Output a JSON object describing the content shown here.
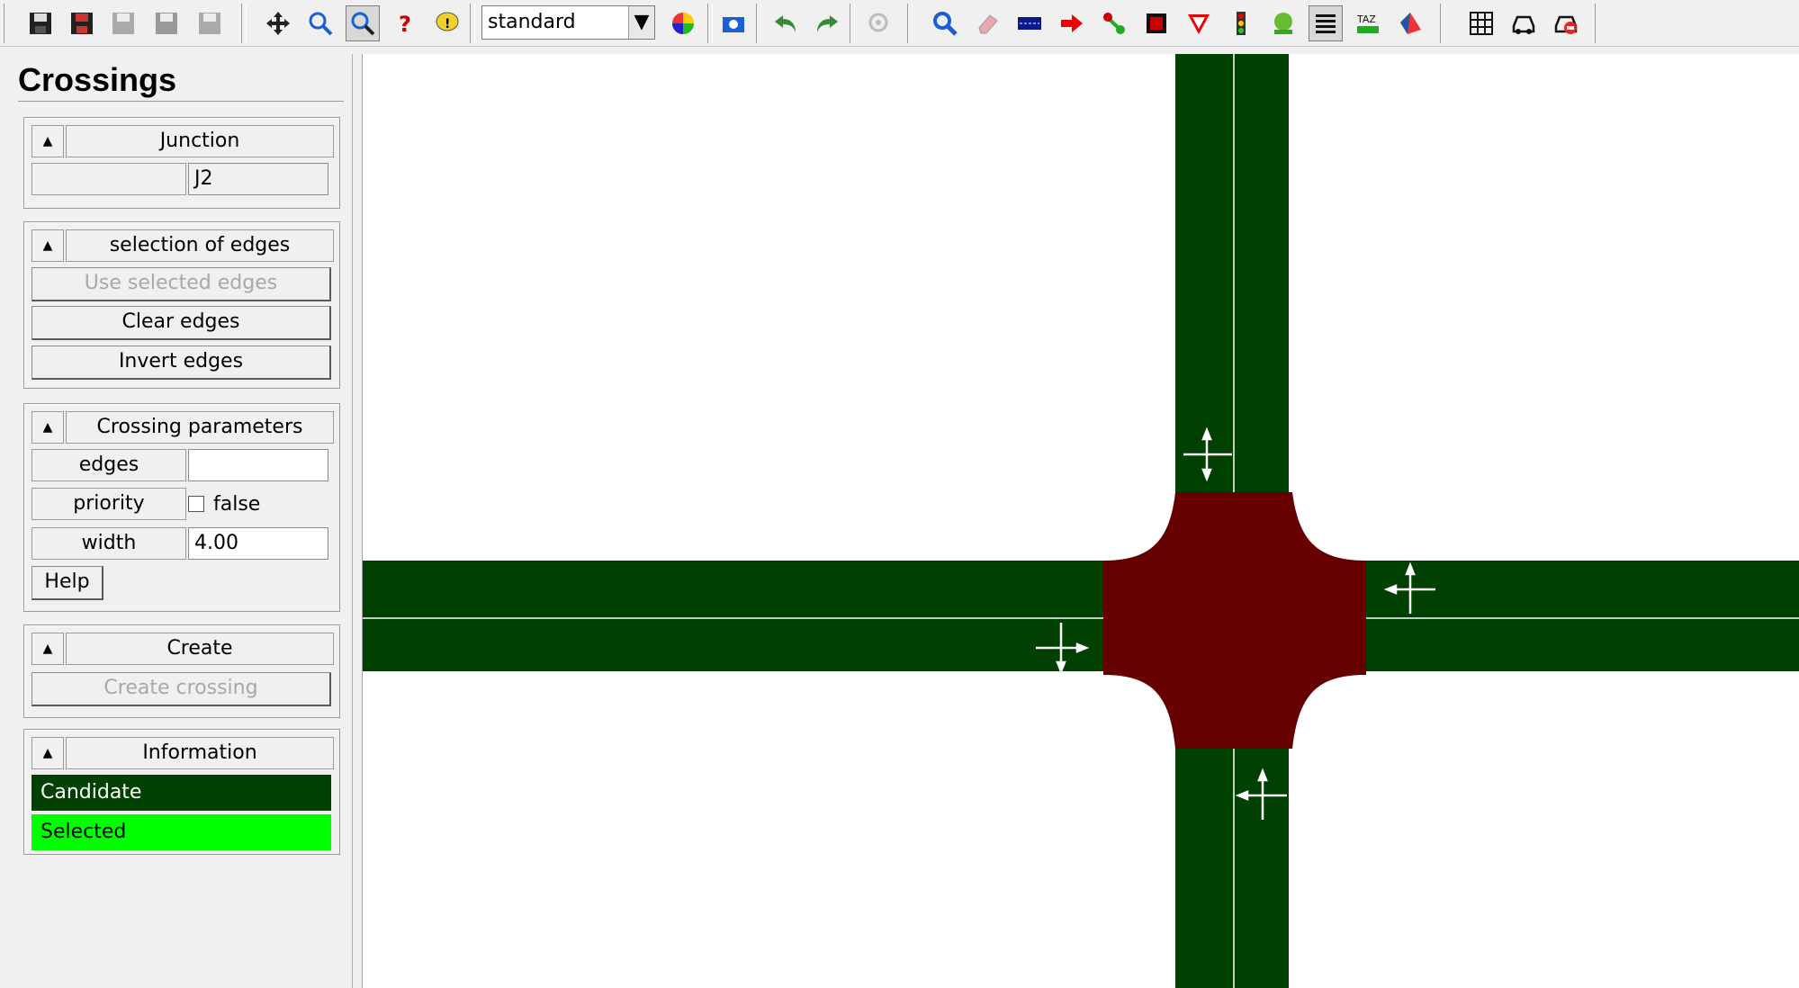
{
  "toolbar": {
    "scheme_select": "standard",
    "icons": [
      "save-network-icon",
      "save-film-icon",
      "save-disabled-icon",
      "save-as-disabled-icon",
      "save-all-disabled-icon",
      "move-mode-icon",
      "zoom-icon",
      "inspect-mode-icon",
      "help-icon",
      "message-icon",
      "color-wheel-icon",
      "screenshot-icon",
      "undo-icon",
      "redo-icon",
      "settings-disabled-icon",
      "inspect-icon",
      "delete-icon",
      "create-edge-icon",
      "connection-icon",
      "prohibition-icon",
      "crossing-icon",
      "yield-icon",
      "traffic-light-icon",
      "additional-icon",
      "crossings-mode-icon",
      "taz-icon",
      "polygon-icon",
      "grid-icon",
      "vehicle-icon",
      "route-icon"
    ]
  },
  "panel": {
    "title": "Crossings",
    "junction": {
      "header": "Junction",
      "id_label": "",
      "id_value": "J2"
    },
    "edge_selection": {
      "header": "selection of edges",
      "use_selected": "Use selected edges",
      "clear": "Clear edges",
      "invert": "Invert edges"
    },
    "params": {
      "header": "Crossing parameters",
      "edges_label": "edges",
      "edges_value": "",
      "priority_label": "priority",
      "priority_value": "false",
      "width_label": "width",
      "width_value": "4.00",
      "help": "Help"
    },
    "create": {
      "header": "Create",
      "button": "Create crossing"
    },
    "information": {
      "header": "Information",
      "candidate": "Candidate",
      "selected": "Selected",
      "candidate_color": "#004000",
      "selected_color": "#00ff00"
    }
  },
  "canvas": {
    "road_color": "#004000",
    "junction_color": "#660000"
  }
}
